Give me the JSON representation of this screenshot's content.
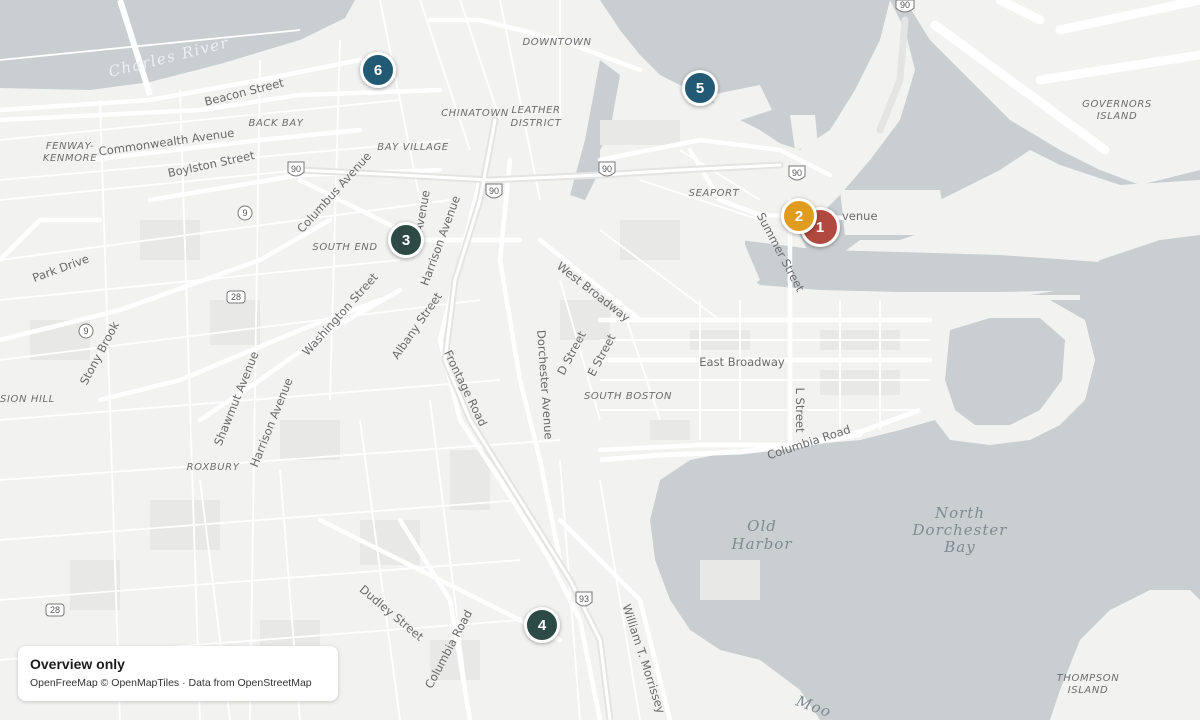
{
  "map": {
    "districts": {
      "downtown": "DOWNTOWN",
      "chinatown": "CHINATOWN",
      "leather_district_1": "LEATHER",
      "leather_district_2": "DISTRICT",
      "back_bay": "BACK BAY",
      "bay_village": "BAY VILLAGE",
      "fenway_1": "FENWAY-",
      "fenway_2": "KENMORE",
      "seaport": "SEAPORT",
      "south_end": "SOUTH END",
      "south_boston": "SOUTH BOSTON",
      "roxbury": "ROXBURY",
      "mission_hill": "SION HILL",
      "governors_1": "GOVERNORS",
      "governors_2": "ISLAND",
      "thompson_1": "THOMPSON",
      "thompson_2": "ISLAND"
    },
    "streets": {
      "beacon": "Beacon Street",
      "commonwealth": "Commonwealth Avenue",
      "boylston": "Boylston Street",
      "columbus": "Columbus Avenue",
      "harrison_upper": "Harrison Avenue",
      "washington": "Washington Street",
      "albany": "Albany Street",
      "west_broadway": "West Broadway",
      "summer": "Summer Street",
      "congress_partial": "venue",
      "east_broadway": "East Broadway",
      "d_street": "D Street",
      "e_street": "E Street",
      "l_street": "L Street",
      "columbia_road": "Columbia Road",
      "frontage": "Frontage Road",
      "dorchester": "Dorchester Avenue",
      "shawmut": "Shawmut Avenue",
      "harrison_lower": "Harrison Avenue",
      "dudley": "Dudley Street",
      "columbia_lower": "Columbia Road",
      "morrissey": "William T. Morrissey",
      "park_drive": "Park Drive",
      "stony_brook": "Stony Brook",
      "v_avenue": "Avenue"
    },
    "water": {
      "charles_river": "Charles River",
      "old_harbor_1": "Old",
      "old_harbor_2": "Harbor",
      "north_dorchester_1": "North",
      "north_dorchester_2": "Dorchester",
      "north_dorchester_3": "Bay",
      "moon_partial": "Moo"
    },
    "shields": {
      "i90_a": "90",
      "i90_b": "90",
      "i90_c": "90",
      "i90_d": "90",
      "i90_e": "90",
      "i93": "93",
      "r9_a": "9",
      "r9_b": "9",
      "r28_a": "28",
      "r28_b": "28"
    },
    "colors": {
      "land": "#f2f2f1",
      "water": "#c9ced1",
      "road": "#ffffff"
    }
  },
  "markers": [
    {
      "label": "1",
      "color": "#b04a3e"
    },
    {
      "label": "2",
      "color": "#e09c1f"
    },
    {
      "label": "3",
      "color": "#2e4a45"
    },
    {
      "label": "4",
      "color": "#2e4a45"
    },
    {
      "label": "5",
      "color": "#235a73"
    },
    {
      "label": "6",
      "color": "#235a73"
    }
  ],
  "attribution": {
    "title": "Overview only",
    "credit": "OpenFreeMap © OpenMapTiles · Data from OpenStreetMap"
  }
}
